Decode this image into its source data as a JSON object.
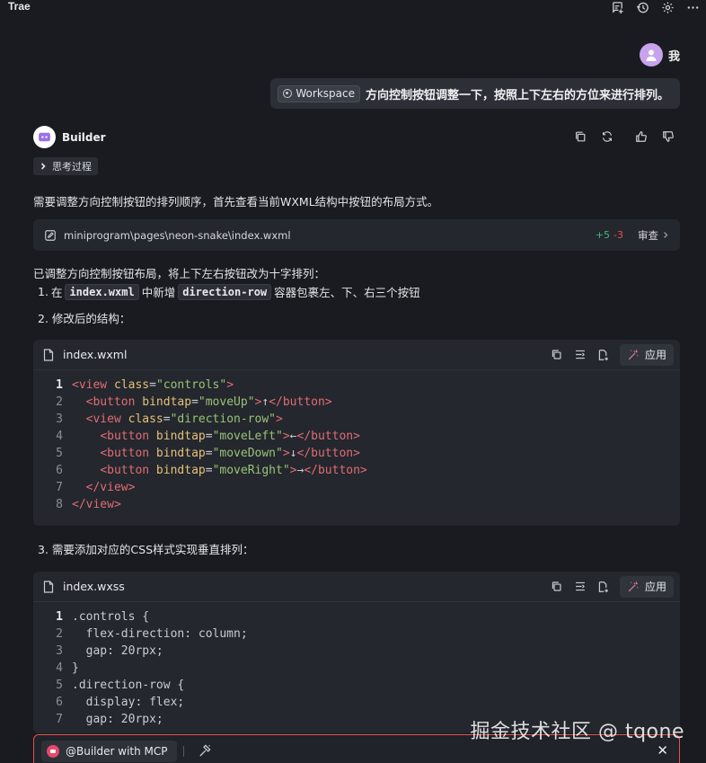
{
  "app": {
    "title": "Trae"
  },
  "topbar": {
    "icons": [
      "chat-add-icon",
      "history-icon",
      "gear-icon",
      "more-icon"
    ]
  },
  "user": {
    "name": "我",
    "workspace_chip": "Workspace",
    "message": "方向控制按钮调整一下，按照上下左右的方位来进行排列。"
  },
  "builder": {
    "name": "Builder",
    "thinking_label": "思考过程",
    "intro": "需要调整方向控制按钮的排列顺序，首先查看当前WXML结构中按钮的布局方式。",
    "file_change": {
      "path": "miniprogram\\pages\\neon-snake\\index.wxml",
      "added": "+5",
      "removed": "-3",
      "review_label": "审查"
    },
    "summary": "已调整方向控制按钮布局，将上下左右按钮改为十字排列：",
    "list": {
      "item1_num": "1.",
      "item1_pre": "在",
      "item1_code1": "index.wxml",
      "item1_mid": "中新增",
      "item1_code2": "direction-row",
      "item1_post": "容器包裹左、下、右三个按钮",
      "item2": "2. 修改后的结构：",
      "item3": "3. 需要添加对应的CSS样式实现垂直排列："
    }
  },
  "code_blocks": [
    {
      "filename": "index.wxml",
      "apply_label": "应用",
      "lines": [
        {
          "n": "1",
          "parts": [
            [
              "tg",
              "<view"
            ],
            [
              "at",
              " class"
            ],
            [
              "pn",
              "="
            ],
            [
              "st",
              "\"controls\""
            ],
            [
              "tg",
              ">"
            ]
          ]
        },
        {
          "n": "2",
          "parts": [
            [
              "pn",
              "  "
            ],
            [
              "tg",
              "<button"
            ],
            [
              "at",
              " bindtap"
            ],
            [
              "pn",
              "="
            ],
            [
              "st",
              "\"moveUp\""
            ],
            [
              "tg",
              ">"
            ],
            [
              "pn",
              "↑"
            ],
            [
              "tg",
              "</button>"
            ]
          ]
        },
        {
          "n": "3",
          "parts": [
            [
              "pn",
              "  "
            ],
            [
              "tg",
              "<view"
            ],
            [
              "at",
              " class"
            ],
            [
              "pn",
              "="
            ],
            [
              "st",
              "\"direction-row\""
            ],
            [
              "tg",
              ">"
            ]
          ]
        },
        {
          "n": "4",
          "parts": [
            [
              "pn",
              "    "
            ],
            [
              "tg",
              "<button"
            ],
            [
              "at",
              " bindtap"
            ],
            [
              "pn",
              "="
            ],
            [
              "st",
              "\"moveLeft\""
            ],
            [
              "tg",
              ">"
            ],
            [
              "pn",
              "←"
            ],
            [
              "tg",
              "</button>"
            ]
          ]
        },
        {
          "n": "5",
          "parts": [
            [
              "pn",
              "    "
            ],
            [
              "tg",
              "<button"
            ],
            [
              "at",
              " bindtap"
            ],
            [
              "pn",
              "="
            ],
            [
              "st",
              "\"moveDown\""
            ],
            [
              "tg",
              ">"
            ],
            [
              "pn",
              "↓"
            ],
            [
              "tg",
              "</button>"
            ]
          ]
        },
        {
          "n": "6",
          "parts": [
            [
              "pn",
              "    "
            ],
            [
              "tg",
              "<button"
            ],
            [
              "at",
              " bindtap"
            ],
            [
              "pn",
              "="
            ],
            [
              "st",
              "\"moveRight\""
            ],
            [
              "tg",
              ">"
            ],
            [
              "pn",
              "→"
            ],
            [
              "tg",
              "</button>"
            ]
          ]
        },
        {
          "n": "7",
          "parts": [
            [
              "pn",
              "  "
            ],
            [
              "tg",
              "</view>"
            ]
          ]
        },
        {
          "n": "8",
          "parts": [
            [
              "tg",
              "</view>"
            ]
          ]
        }
      ]
    },
    {
      "filename": "index.wxss",
      "apply_label": "应用",
      "lines": [
        {
          "n": "1",
          "parts": [
            [
              "pn",
              ".controls {"
            ]
          ]
        },
        {
          "n": "2",
          "parts": [
            [
              "pn",
              "  flex-direction: column;"
            ]
          ]
        },
        {
          "n": "3",
          "parts": [
            [
              "pn",
              "  gap: 20rpx;"
            ]
          ]
        },
        {
          "n": "4",
          "parts": [
            [
              "pn",
              "}"
            ]
          ]
        },
        {
          "n": "5",
          "parts": [
            [
              "pn",
              ".direction-row {"
            ]
          ]
        },
        {
          "n": "6",
          "parts": [
            [
              "pn",
              "  display: flex;"
            ]
          ]
        },
        {
          "n": "7",
          "parts": [
            [
              "pn",
              "  gap: 20rpx;"
            ]
          ]
        }
      ]
    }
  ],
  "composer": {
    "chip_label": "@Builder with MCP"
  },
  "watermark": "掘金技术社区 @ tqone",
  "colors": {
    "accent_red": "#e5534b",
    "diff_add": "#3fb87a",
    "avatar": "#c8a2ec",
    "mcp_logo": "#e8486b"
  }
}
